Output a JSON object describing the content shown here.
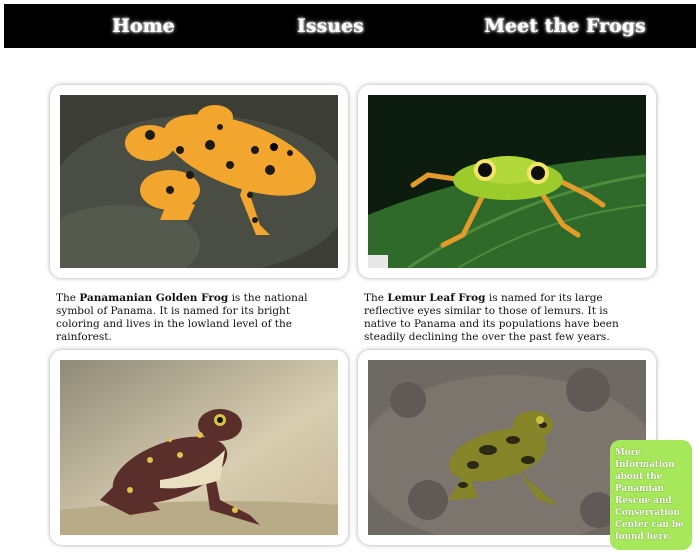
{
  "nav": {
    "home": "Home",
    "issues": "Issues",
    "meet_frogs": "Meet the Frogs"
  },
  "frogs": [
    {
      "prefix": "The ",
      "name": "Panamanian Golden Frog",
      "text": " is the national symbol of Panama. It is named for its bright coloring and lives in the lowland level of the rainforest."
    },
    {
      "prefix": "The ",
      "name": "Lemur Leaf Frog",
      "text": " is named for its large reflective eyes similar to those of lemurs. It is native to Panama and its populations have been steadily declining the over the past few years."
    }
  ],
  "info_box": {
    "text": "More Information about the Panamian Rescue and Conservation Center can be found here."
  },
  "colors": {
    "nav_bg": "#000000",
    "info_bg": "#a6e85a"
  }
}
